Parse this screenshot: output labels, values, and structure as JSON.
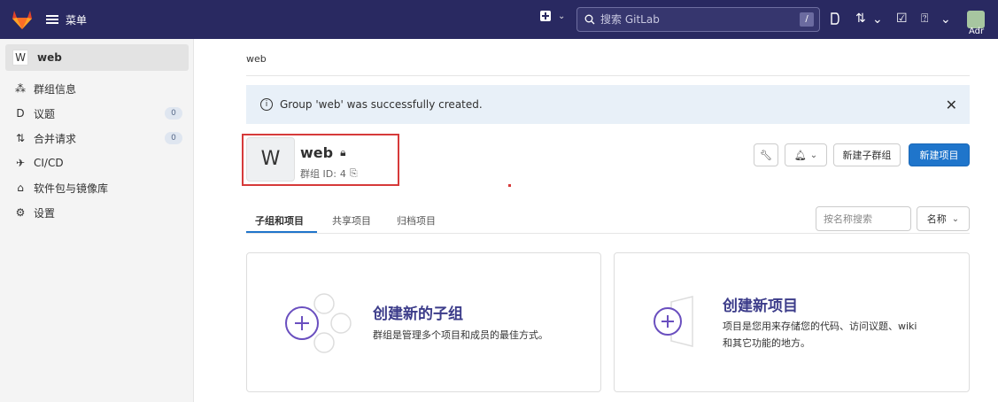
{
  "topbar": {
    "menu_label": "菜单",
    "search_placeholder": "搜索 GitLab",
    "search_shortcut": "/",
    "user_label": "Adr"
  },
  "sidebar": {
    "group_initial": "W",
    "group_name": "web",
    "items": [
      {
        "label": "群组信息",
        "icon": "group-info-icon",
        "badge": ""
      },
      {
        "label": "议题",
        "icon": "issues-icon",
        "badge": "0"
      },
      {
        "label": "合并请求",
        "icon": "merge-request-icon",
        "badge": "0"
      },
      {
        "label": "CI/CD",
        "icon": "rocket-icon",
        "badge": ""
      },
      {
        "label": "软件包与镜像库",
        "icon": "package-icon",
        "badge": ""
      },
      {
        "label": "设置",
        "icon": "gear-icon",
        "badge": ""
      }
    ]
  },
  "main": {
    "breadcrumb": "web",
    "alert_text": "Group 'web' was successfully created.",
    "group": {
      "initial": "W",
      "name": "web",
      "id_label": "群组 ID:",
      "id_value": "4"
    },
    "buttons": {
      "new_subgroup": "新建子群组",
      "new_project": "新建项目"
    },
    "tabs": [
      "子组和项目",
      "共享项目",
      "归档项目"
    ],
    "filter_placeholder": "按名称搜索",
    "sort_label": "名称",
    "cards": [
      {
        "title": "创建新的子组",
        "desc": "群组是管理多个项目和成员的最佳方式。"
      },
      {
        "title": "创建新项目",
        "desc_line1": "项目是您用来存储您的代码、访问议题、wiki",
        "desc_line2": "和其它功能的地方。"
      }
    ]
  },
  "colors": {
    "topbar": "#292961",
    "primary": "#1f75cb",
    "highlight_box": "#d63a3a",
    "card_accent": "#6a4fbf"
  }
}
